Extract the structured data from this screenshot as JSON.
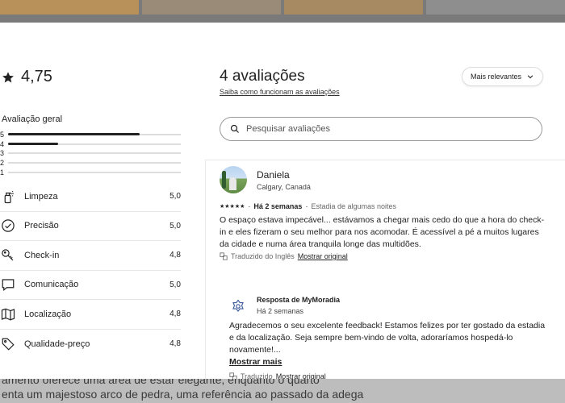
{
  "summary": {
    "overall_rating": "4,75",
    "overall_label": "Avaliação geral",
    "distribution": [
      {
        "stars": "5",
        "fraction": 0.76
      },
      {
        "stars": "4",
        "fraction": 0.29
      },
      {
        "stars": "3",
        "fraction": 0
      },
      {
        "stars": "2",
        "fraction": 0
      },
      {
        "stars": "1",
        "fraction": 0
      }
    ],
    "categories": [
      {
        "label": "Limpeza",
        "value": "5,0",
        "icon": "spray-bottle-icon"
      },
      {
        "label": "Precisão",
        "value": "5,0",
        "icon": "check-circle-icon"
      },
      {
        "label": "Check-in",
        "value": "4,8",
        "icon": "key-icon"
      },
      {
        "label": "Comunicação",
        "value": "5,0",
        "icon": "chat-bubble-icon"
      },
      {
        "label": "Localização",
        "value": "4,8",
        "icon": "map-icon"
      },
      {
        "label": "Qualidade-preço",
        "value": "4,8",
        "icon": "price-tag-icon"
      }
    ]
  },
  "reviews_header": {
    "title": "4 avaliações",
    "how_link": "Saiba como funcionam as avaliações",
    "sort_label": "Mais relevantes"
  },
  "search": {
    "placeholder": "Pesquisar avaliações"
  },
  "review": {
    "name": "Daniela",
    "location": "Calgary, Canadá",
    "stars": "★★★★★",
    "rating": 5,
    "time": "Há 2 semanas",
    "separator": "·",
    "stay": "Estadia de algumas noites",
    "text": "O espaço estava impecável... estávamos a chegar mais cedo do que a hora do check-in e eles fizeram o seu melhor para nos acomodar. É acessível a pé a muitos lugares da cidade e numa área tranquila longe das multidões.",
    "translated": "Traduzido do Inglês",
    "show_original": "Mostrar original"
  },
  "host_response": {
    "title": "Resposta de MyMoradia",
    "time": "Há 2 semanas",
    "text": "Agradecemos o seu excelente feedback! Estamos felizes por ter gostado da estadia e da localização. Seja sempre bem-vindo de volta, adoraríamos hospedá-lo novamente!...",
    "show_more": "Mostrar mais",
    "translated": "Traduzido",
    "show_original": "Mostrar original"
  },
  "background": {
    "text_line1": "amento oferece uma área de estar elegante, enquanto o quarto",
    "text_line2": "enta um majestoso arco de pedra, uma referência ao passado da adega"
  },
  "colors": {
    "text": "#222222",
    "divider": "#e6e6e6",
    "overlay": "#7a7a7a"
  }
}
